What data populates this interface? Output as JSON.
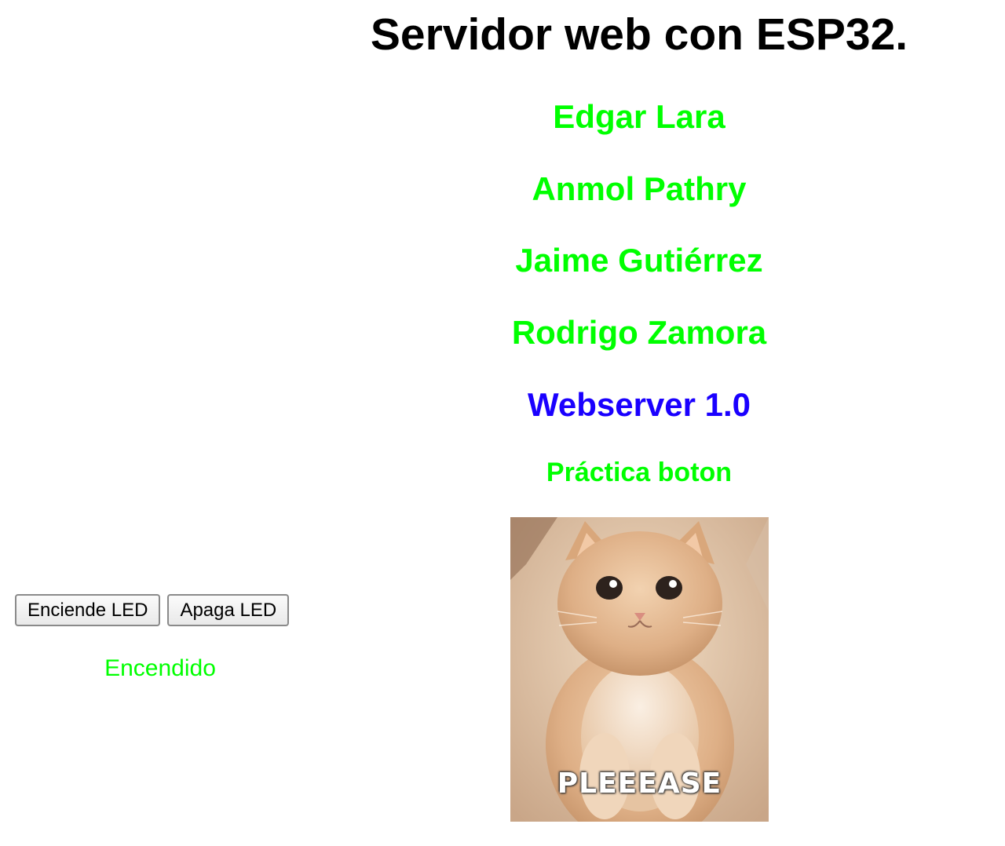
{
  "page": {
    "title": "Servidor web con ESP32.",
    "names": [
      "Edgar Lara",
      "Anmol Pathry",
      "Jaime Gutiérrez",
      "Rodrigo Zamora"
    ],
    "version": "Webserver 1.0",
    "subtitle": "Práctica boton"
  },
  "controls": {
    "on_label": "Enciende LED",
    "off_label": "Apaga LED",
    "status": "Encendido"
  },
  "image": {
    "caption": "PLEEEASE"
  },
  "colors": {
    "names": "#00ff00",
    "version": "#1a00ff",
    "status": "#00ff00"
  }
}
